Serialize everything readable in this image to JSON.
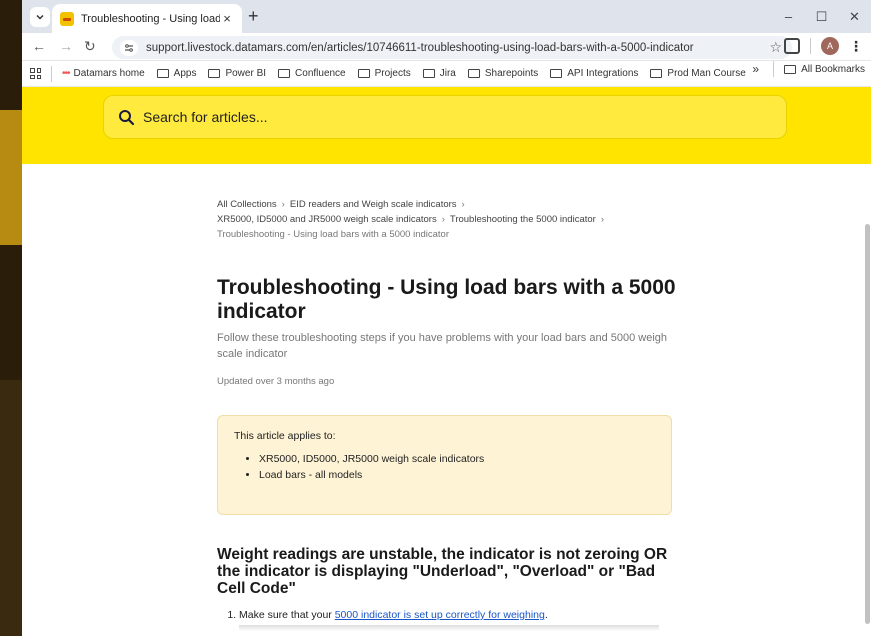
{
  "tab": {
    "title": "Troubleshooting - Using load b",
    "close": "×",
    "new_tab": "+"
  },
  "window": {
    "minimize": "–",
    "maximize": "☐",
    "close": "✕"
  },
  "toolbar": {
    "url": "support.livestock.datamars.com/en/articles/10746611-troubleshooting-using-load-bars-with-a-5000-indicator",
    "avatar_initial": "A"
  },
  "bookmarks": {
    "items": [
      "Datamars home",
      "Apps",
      "Power BI",
      "Confluence",
      "Projects",
      "Jira",
      "Sharepoints",
      "API Integrations",
      "Prod Man Course"
    ],
    "overflow": "»",
    "all": "All Bookmarks"
  },
  "search": {
    "placeholder": "Search for articles..."
  },
  "breadcrumbs": {
    "c1": "All Collections",
    "c2": "EID readers and Weigh scale indicators",
    "c3": "XR5000, ID5000 and JR5000 weigh scale indicators",
    "c4": "Troubleshooting the 5000 indicator",
    "current": "Troubleshooting - Using load bars with a 5000 indicator"
  },
  "article": {
    "title": "Troubleshooting - Using load bars with a 5000 indicator",
    "subtitle": "Follow these troubleshooting steps if you have problems with your load bars and 5000 weigh scale indicator",
    "updated": "Updated over 3 months ago"
  },
  "callout": {
    "lead": "This article applies to:",
    "items": [
      "XR5000, ID5000, JR5000 weigh scale indicators",
      "Load bars - all models"
    ]
  },
  "section": {
    "heading": "Weight readings are unstable, the indicator is not zeroing OR the indicator is displaying \"Underload\", \"Overload\" or \"Bad Cell Code\"",
    "step1_prefix": "Make sure that your ",
    "step1_link": "5000 indicator is set up correctly for weighing",
    "step1_suffix": "."
  },
  "colors": {
    "brand_yellow": "#ffe400",
    "link": "#1a55c8"
  }
}
